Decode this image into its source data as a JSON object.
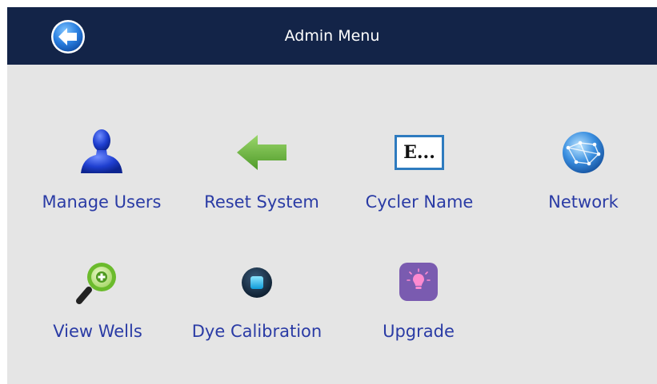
{
  "header": {
    "title": "Admin Menu",
    "back_icon": "back-arrow-icon"
  },
  "menu": {
    "items": [
      {
        "label": "Manage Users",
        "icon": "user-icon"
      },
      {
        "label": "Reset System",
        "icon": "green-left-arrow-icon"
      },
      {
        "label": "Cycler Name",
        "icon": "text-field-icon",
        "icon_text": "E..."
      },
      {
        "label": "Network",
        "icon": "globe-network-icon"
      },
      {
        "label": "View Wells",
        "icon": "magnifier-plus-icon"
      },
      {
        "label": "Dye Calibration",
        "icon": "stop-circle-icon"
      },
      {
        "label": "Upgrade",
        "icon": "lightbulb-icon"
      }
    ]
  },
  "colors": {
    "header_bg": "#132448",
    "screen_bg": "#e5e5e5",
    "label_color": "#2a3ba5"
  }
}
